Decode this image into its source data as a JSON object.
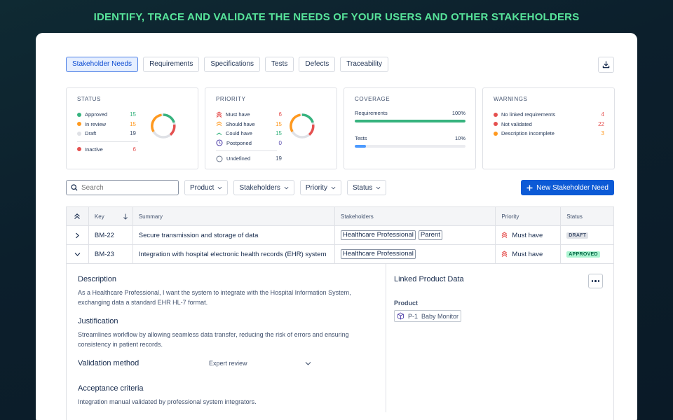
{
  "hero_text": "IDENTIFY, TRACE AND VALIDATE THE NEEDS OF YOUR USERS AND OTHER STAKEHOLDERS",
  "tabs": [
    {
      "label": "Stakeholder Needs",
      "active": true
    },
    {
      "label": "Requirements",
      "active": false
    },
    {
      "label": "Specifications",
      "active": false
    },
    {
      "label": "Tests",
      "active": false
    },
    {
      "label": "Defects",
      "active": false
    },
    {
      "label": "Traceability",
      "active": false
    }
  ],
  "download_icon": "download-icon",
  "status_panel": {
    "title": "STATUS",
    "items": [
      {
        "label": "Approved",
        "value": "15",
        "color": "#36b37e"
      },
      {
        "label": "In review",
        "value": "15",
        "color": "#ff991f"
      },
      {
        "label": "Draft",
        "value": "19",
        "color": "#dfe1e6"
      },
      {
        "label": "Inactive",
        "value": "6",
        "color": "#e5504f"
      }
    ]
  },
  "priority_panel": {
    "title": "PRIORITY",
    "items": [
      {
        "label": "Must have",
        "value": "6",
        "color": "#e5504f",
        "icon": "triple-chevron-up-icon"
      },
      {
        "label": "Should have",
        "value": "15",
        "color": "#ff991f",
        "icon": "double-chevron-up-icon"
      },
      {
        "label": "Could have",
        "value": "15",
        "color": "#36b37e",
        "icon": "chevron-up-icon"
      },
      {
        "label": "Postponed",
        "value": "0",
        "color": "#5243aa",
        "icon": "clock-icon"
      },
      {
        "label": "Undefined",
        "value": "19",
        "color": "#172b4d",
        "icon": "empty-circle-icon"
      }
    ]
  },
  "coverage_panel": {
    "title": "COVERAGE",
    "items": [
      {
        "label": "Requirements",
        "value": "100%",
        "fraction": 1.0,
        "color": "#36b37e"
      },
      {
        "label": "Tests",
        "value": "10%",
        "fraction": 0.1,
        "color": "#4c9aff"
      }
    ]
  },
  "warnings_panel": {
    "title": "WARNINGS",
    "items": [
      {
        "label": "No linked requirements",
        "value": "4",
        "color": "#e5504f"
      },
      {
        "label": "Not validated",
        "value": "22",
        "color": "#e5504f"
      },
      {
        "label": "Description incomplete",
        "value": "3",
        "color": "#ff991f"
      }
    ]
  },
  "filters": {
    "search_placeholder": "Search",
    "dropdowns": [
      "Product",
      "Stakeholders",
      "Priority",
      "Status"
    ],
    "new_button": "New Stakeholder Need"
  },
  "table": {
    "headers": [
      "Key",
      "Summary",
      "Stakeholders",
      "Priority",
      "Status"
    ],
    "rows": [
      {
        "key": "BM-22",
        "summary": "Secure transmission and storage of data",
        "stakeholders": [
          "Healthcare Professional",
          "Parent"
        ],
        "priority": "Must have",
        "status": "DRAFT",
        "expanded": false
      },
      {
        "key": "BM-23",
        "summary": "Integration with hospital electronic health records (EHR) system",
        "stakeholders": [
          "Healthcare Professional"
        ],
        "priority": "Must have",
        "status": "APPROVED",
        "expanded": true
      }
    ]
  },
  "detail": {
    "description_heading": "Description",
    "description": "As a Healthcare Professional, I want the system to integrate with the Hospital Information System, exchanging data a standard EHR HL-7 format.",
    "justification_heading": "Justification",
    "justification": "Streamlines workflow by allowing seamless data transfer, reducing the risk of errors and ensuring consistency in patient records.",
    "validation_heading": "Validation method",
    "validation_value": "Expert review",
    "acceptance_heading": "Acceptance criteria",
    "acceptance": "Integration manual validated by professional system integrators.",
    "linked_heading": "Linked Product Data",
    "product_label": "Product",
    "product_key": "P-1",
    "product_name": "Baby Monitor"
  }
}
